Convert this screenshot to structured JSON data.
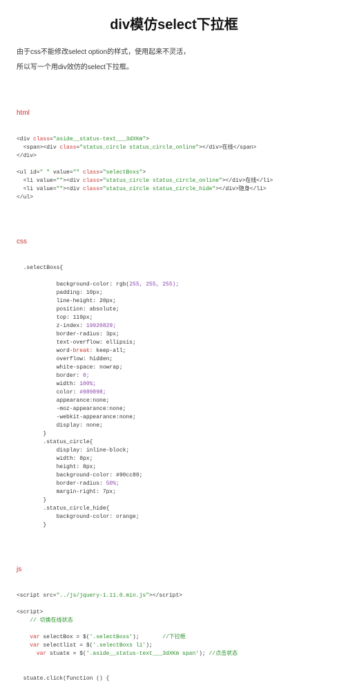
{
  "title": "div模仿select下拉框",
  "intro_line1": "由于css不能修改select option的样式，使用起来不灵活，",
  "intro_line2": "所以写一个用div效仿的select下拉框。",
  "sections": {
    "html": "html",
    "css": "css",
    "js": "js"
  },
  "html_code": {
    "l1_a": "<div ",
    "l1_class": "class",
    "l1_b": "=",
    "l1_val": "\"aside__status-text___3dXKm\"",
    "l1_c": ">",
    "l2_a": "<span><div ",
    "l2_class": "class",
    "l2_b": "=",
    "l2_val": "\"status_circle status_circle_online\"",
    "l2_c": "></div>在线</span>",
    "l3": "</div>",
    "l4_a": "<ul id=",
    "l4_id": "\" \"",
    "l4_b": " value=",
    "l4_v": "\"\"",
    "l4_c": " ",
    "l4_class": "class",
    "l4_d": "=",
    "l4_val": "\"selectBoxs\"",
    "l4_e": ">",
    "l5_a": "<li value=",
    "l5_v": "\"\"",
    "l5_b": "><div ",
    "l5_class": "class",
    "l5_c": "=",
    "l5_val": "\"status_circle status_circle_online\"",
    "l5_d": "></div>在线</li>",
    "l6_a": "<li value=",
    "l6_v": "\"\"",
    "l6_b": "><div ",
    "l6_class": "class",
    "l6_c": "=",
    "l6_val": "\"status_circle status_circle_hide\"",
    "l6_d": "></div>隐身</li>",
    "l7": "</ul>"
  },
  "css_code": {
    "sel1": ".selectBoxs{",
    "p1_a": "background-color: rgb(",
    "p1_v": "255, 255, 255);",
    "p2": "padding: 10px;",
    "p3": "line-height: 20px;",
    "p4": "position: absolute;",
    "p5": "top: 119px;",
    "p6_a": "z-index: ",
    "p6_v": "19920829;",
    "p7": "border-radius: 3px;",
    "p8": "text-overflow: ellipsis;",
    "p9_a": "word-",
    "p9_b": "break",
    "p9_c": ": keep-all;",
    "p10": "overflow: hidden;",
    "p11": "white-space: nowrap;",
    "p12_a": "border: ",
    "p12_v": "0;",
    "p13_a": "width: ",
    "p13_v": "100%;",
    "p14_a": "color: ",
    "p14_v": "#989898;",
    "p15": "appearance:none;",
    "p16": "-moz-appearance:none;",
    "p17": "-webkit-appearance:none;",
    "p18": "display: none;",
    "close1": "}",
    "sel2": ".status_circle{",
    "p19": "display: inline-block;",
    "p20": "width: 8px;",
    "p21": "height: 8px;",
    "p22": "background-color: #90cc80;",
    "p23_a": "border-radius: ",
    "p23_v": "50%;",
    "p24": "margin-right: 7px;",
    "close2": "}",
    "sel3": ".status_circle_hide{",
    "p25": "background-color: orange;",
    "close3": "}"
  },
  "js_code": {
    "l1_a": "<script src=",
    "l1_v": "\"../js/jquery-1.11.0.min.js\"",
    "l1_b": "></script>",
    "l2": "<script>",
    "c1": "// 切换在线状态",
    "l3_var": "var",
    "l3_a": " selectBox = $(",
    "l3_v": "'.selectBoxs'",
    "l3_b": ");",
    "l3_c": "       //下拉框",
    "l4_var": "var",
    "l4_a": " selectlist = $(",
    "l4_v": "'.selectBoxs li'",
    "l4_b": ");",
    "l5_var": "var",
    "l5_a": " stuate = $(",
    "l5_v": "'.aside__status-text___3dXKm span'",
    "l5_b": "); ",
    "l5_c": "//点击状态",
    "l6": "stuate.click(function () {"
  }
}
